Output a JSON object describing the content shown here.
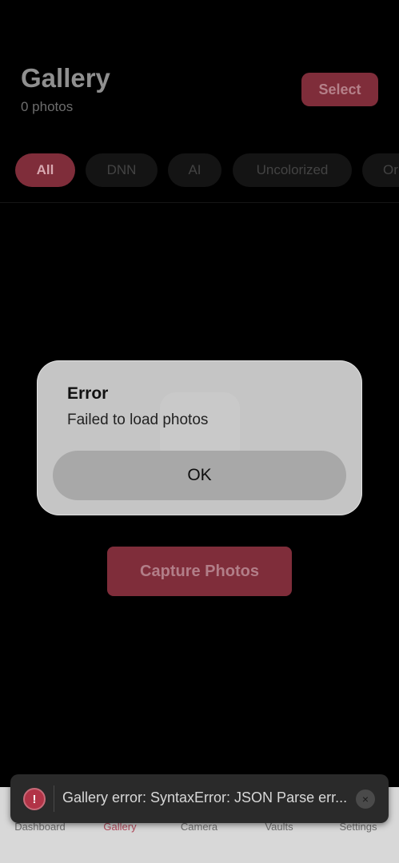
{
  "header": {
    "title": "Gallery",
    "count": "0 photos",
    "select_label": "Select"
  },
  "filters": [
    {
      "label": "All",
      "active": true
    },
    {
      "label": "DNN",
      "active": false
    },
    {
      "label": "AI",
      "active": false
    },
    {
      "label": "Uncolorized",
      "active": false
    },
    {
      "label": "Or",
      "active": false
    }
  ],
  "empty": {
    "capture_label": "Capture Photos"
  },
  "dialog": {
    "title": "Error",
    "message": "Failed to load photos",
    "ok_label": "OK"
  },
  "tabs": [
    {
      "label": "Dashboard",
      "active": false
    },
    {
      "label": "Gallery",
      "active": true
    },
    {
      "label": "Camera",
      "active": false
    },
    {
      "label": "Vaults",
      "active": false
    },
    {
      "label": "Settings",
      "active": false
    }
  ],
  "toast": {
    "icon": "!",
    "message": "Gallery error: SyntaxError: JSON Parse err...",
    "close": "×"
  },
  "colors": {
    "accent": "#7f2d3a",
    "background": "#000000",
    "dialog": "#d6d6d6"
  }
}
